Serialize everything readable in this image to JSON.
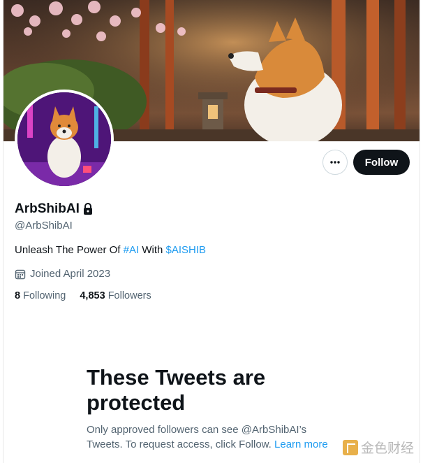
{
  "profile": {
    "display_name": "ArbShibAI",
    "handle": "@ArbShibAI",
    "bio_prefix": "Unleash The Power Of ",
    "bio_hashtag": "#AI",
    "bio_middle": " With ",
    "bio_cashtag": "$AISHIB",
    "joined": "Joined April 2023",
    "following_count": "8",
    "following_label": "Following",
    "followers_count": "4,853",
    "followers_label": "Followers",
    "protected_icon": "lock-icon"
  },
  "actions": {
    "more_icon": "more-options-icon",
    "follow_label": "Follow"
  },
  "protected_notice": {
    "title": "These Tweets are protected",
    "body": "Only approved followers can see @ArbShibAI’s Tweets. To request access, click Follow.",
    "link_label": "Learn more"
  },
  "watermark": {
    "text": "金色财经"
  },
  "colors": {
    "link": "#1d9bf0",
    "follow_bg": "#0f1419",
    "secondary_text": "#536471"
  }
}
